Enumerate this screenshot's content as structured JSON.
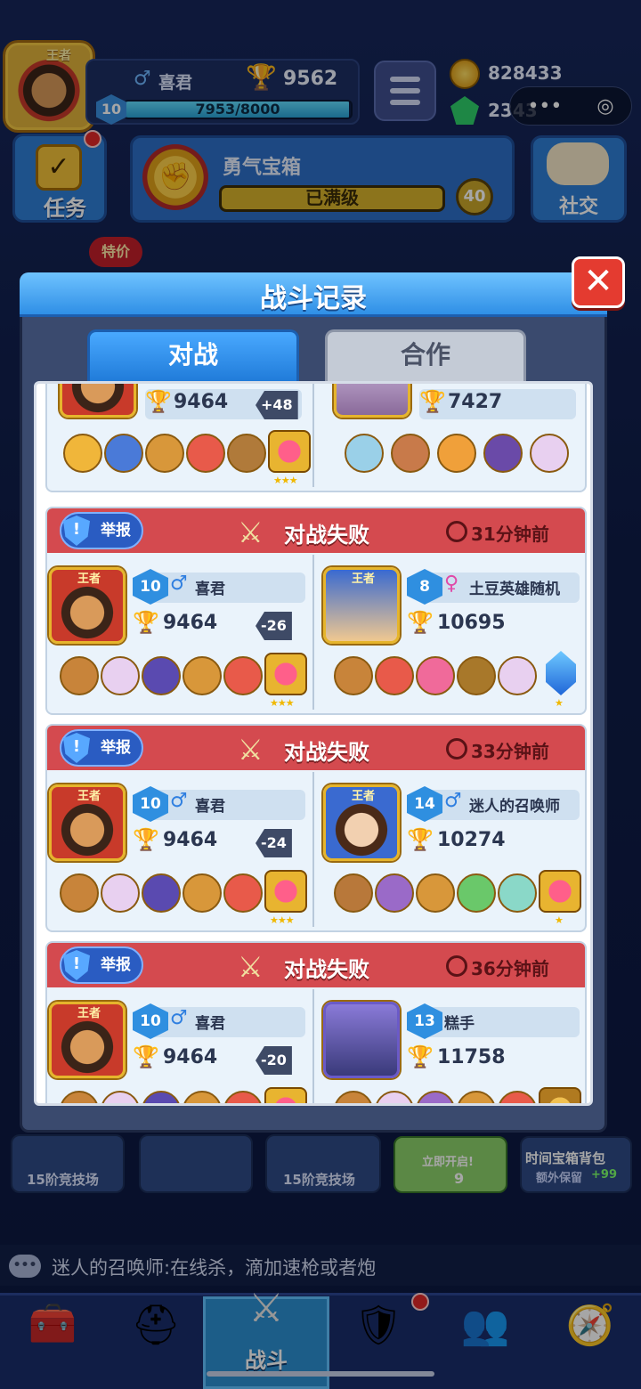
{
  "top": {
    "crown_label": "王者",
    "player_name": "喜君",
    "gender_symbol": "♂",
    "trophies": "9562",
    "level": "10",
    "xp_text": "7953/8000",
    "xp_progress": 0.994,
    "coins": "828433",
    "gems": "2343",
    "capsule_more": "•••",
    "capsule_target": "◎"
  },
  "row2": {
    "task_label": "任务",
    "chest_title": "勇气宝箱",
    "chest_status": "已满级",
    "chest_level": "40",
    "social_label": "社交",
    "sale_tag": "特价"
  },
  "modal": {
    "title": "战斗记录",
    "close": "✕",
    "tabs": [
      "对战",
      "合作"
    ],
    "report_label": "举报",
    "top_partial": {
      "left": {
        "trophies": "9464",
        "delta": "+48"
      },
      "right": {
        "trophies": "7427"
      }
    },
    "records": [
      {
        "result": "对战失败",
        "time": "31分钟前",
        "left": {
          "level": "10",
          "gender": "♂",
          "name": "喜君",
          "trophies": "9464",
          "delta": "-26",
          "crown": "王者"
        },
        "right": {
          "level": "8",
          "gender": "♀",
          "name": "土豆英雄随机",
          "trophies": "10695",
          "crown": "王者"
        }
      },
      {
        "result": "对战失败",
        "time": "33分钟前",
        "left": {
          "level": "10",
          "gender": "♂",
          "name": "喜君",
          "trophies": "9464",
          "delta": "-24",
          "crown": "王者"
        },
        "right": {
          "level": "14",
          "gender": "♂",
          "name": "迷人的召唤师",
          "trophies": "10274",
          "crown": "王者"
        }
      },
      {
        "result": "对战失败",
        "time": "36分钟前",
        "left": {
          "level": "10",
          "gender": "♂",
          "name": "喜君",
          "trophies": "9464",
          "delta": "-20",
          "crown": "王者"
        },
        "right": {
          "level": "13",
          "gender": "",
          "name": "糕手",
          "trophies": "11758",
          "crown": ""
        }
      }
    ]
  },
  "lower": {
    "arena_1": "15阶竞技场",
    "arena_2": "15阶竞技场",
    "open_now": "立即开启!",
    "open_cost": "9",
    "pack_title": "时间宝箱背包",
    "pack_sub": "额外保留",
    "pack_plus": "+99"
  },
  "chat": {
    "text": "迷人的召唤师:在线杀，滴加速枪或者炮"
  },
  "nav": {
    "active_label": "战斗"
  },
  "colors": {
    "accent": "#2f8fe6",
    "loss_header": "#d44a4f",
    "close": "#e43b30",
    "gold": "#f5c21b"
  }
}
